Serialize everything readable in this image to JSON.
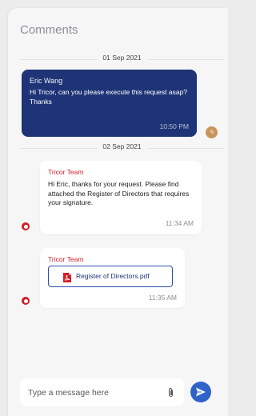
{
  "header": {
    "title": "Comments"
  },
  "dates": {
    "first": "01 Sep 2021",
    "second": "02 Sep 2021"
  },
  "messages": [
    {
      "sender": "Eric Wang",
      "text": "Hi Tricor, can you please execute this request asap?  Thanks",
      "time": "10:50 PM"
    },
    {
      "sender": "Tricor Team",
      "text": "Hi Eric, thanks for your request. Please find attached the Register of Directors that requires your signature.",
      "time": "11:34 AM"
    },
    {
      "sender": "Tricor Team",
      "attachment": "Register of Directors.pdf",
      "time": "11:35 AM"
    }
  ],
  "composer": {
    "placeholder": "Type a message here"
  },
  "icons": {
    "attach": "paperclip-icon",
    "send": "send-icon",
    "pdf": "pdf-file-icon",
    "agent": "tricor-agent-icon",
    "user": "user-avatar"
  },
  "colors": {
    "outgoing_bubble": "#1e3476",
    "brand_red": "#d21f2a",
    "send_button": "#2f63c8",
    "file_border": "#2e4db0"
  }
}
